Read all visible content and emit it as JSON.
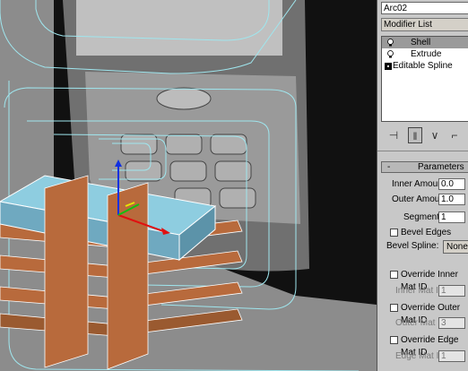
{
  "object_name": "Arc02",
  "modifier_list_label": "Modifier List",
  "modifier_stack": [
    {
      "label": "Shell",
      "icon": "lightbulb-icon",
      "selected": true
    },
    {
      "label": "Extrude",
      "icon": "lightbulb-icon",
      "selected": false
    },
    {
      "label": "Editable Spline",
      "icon": "spline-box-icon",
      "selected": false
    }
  ],
  "toolbar_icons": [
    "pin-stack-icon",
    "show-end-result-icon",
    "make-unique-icon",
    "remove-modifier-icon"
  ],
  "parameters": {
    "rollout_title": "Parameters",
    "rollout_toggle": "-",
    "inner_amount_label": "Inner Amount:",
    "inner_amount_value": "0.0",
    "outer_amount_label": "Outer Amount:",
    "outer_amount_value": "1.0",
    "segments_label": "Segments:",
    "segments_value": "1",
    "bevel_edges_label": "Bevel Edges",
    "bevel_spline_label": "Bevel Spline:",
    "bevel_spline_value": "None",
    "override_inner_label": "Override Inner Mat ID",
    "inner_mat_label": "Inner Mat ID:",
    "inner_mat_value": "1",
    "override_outer_label": "Override Outer Mat ID",
    "outer_mat_label": "Outer Mat ID:",
    "outer_mat_value": "3",
    "override_edge_label": "Override Edge Mat ID",
    "edge_mat_label": "Edge Mat ID:",
    "edge_mat_value": "1"
  },
  "colors": {
    "viewport_bg": "#8c8c8c",
    "wireframe": "#9fe6ee",
    "wood": "#b86a3c",
    "box_top": "#8ecde0",
    "gizmo_x": "#e01010",
    "gizmo_y": "#10c010",
    "gizmo_z": "#1030e0"
  }
}
